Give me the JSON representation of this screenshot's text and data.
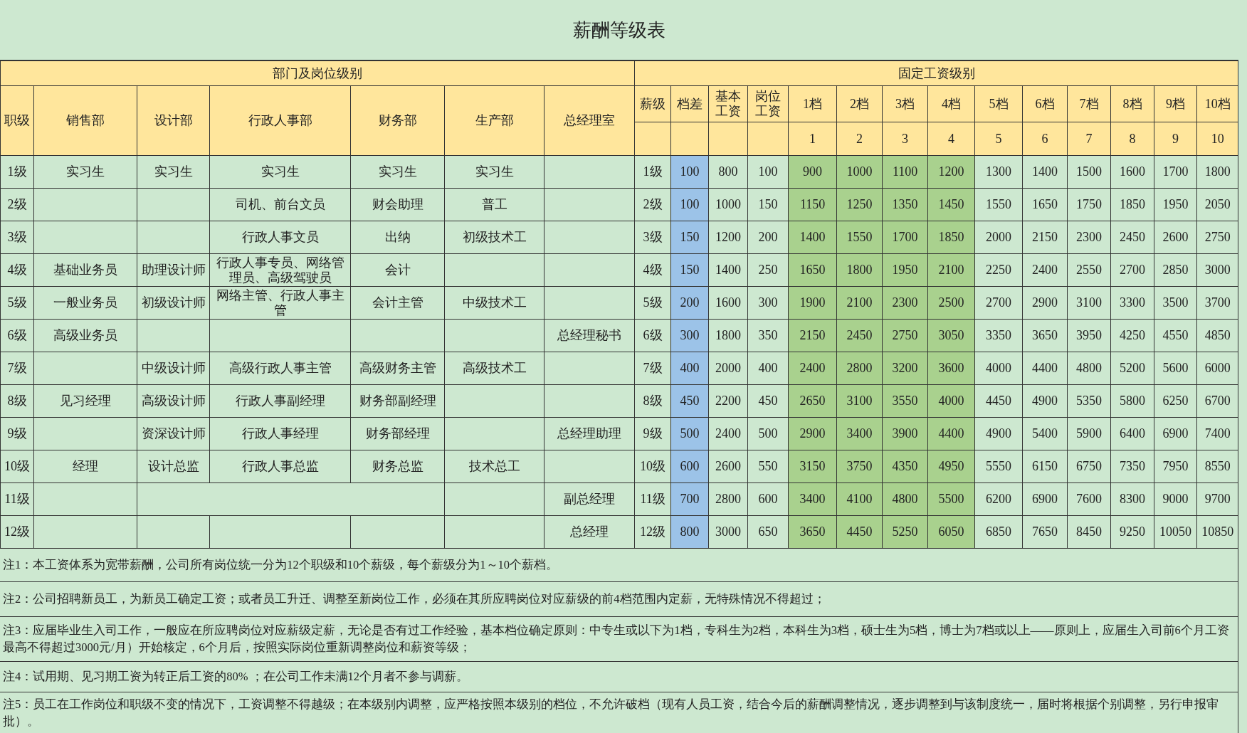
{
  "title": "薪酬等级表",
  "header": {
    "dept_group": "部门及岗位级别",
    "pay_group": "固定工资级别",
    "dept_columns": [
      "职级",
      "销售部",
      "设计部",
      "行政人事部",
      "财务部",
      "生产部",
      "总经理室"
    ],
    "pay_columns": [
      "薪级",
      "档差",
      "基本工资",
      "岗位工资"
    ],
    "step_columns": [
      {
        "label": "1档",
        "number": "1",
        "highlighted": true
      },
      {
        "label": "2档",
        "number": "2",
        "highlighted": true
      },
      {
        "label": "3档",
        "number": "3",
        "highlighted": true
      },
      {
        "label": "4档",
        "number": "4",
        "highlighted": true
      },
      {
        "label": "5档",
        "number": "5",
        "highlighted": false
      },
      {
        "label": "6档",
        "number": "6",
        "highlighted": false
      },
      {
        "label": "7档",
        "number": "7",
        "highlighted": false
      },
      {
        "label": "8档",
        "number": "8",
        "highlighted": false
      },
      {
        "label": "9档",
        "number": "9",
        "highlighted": false
      },
      {
        "label": "10档",
        "number": "10",
        "highlighted": false
      }
    ]
  },
  "rows": [
    {
      "grade": "1级",
      "positions": [
        {
          "kind": "text",
          "text": "实习生"
        },
        {
          "kind": "text",
          "text": "实习生"
        },
        {
          "kind": "text",
          "text": "实习生"
        },
        {
          "kind": "text",
          "text": "实习生"
        },
        {
          "kind": "text",
          "text": "实习生"
        },
        {
          "kind": "blank"
        }
      ],
      "pay_grade": "1级",
      "step_diff": "100",
      "base": "800",
      "post": "100",
      "steps": [
        "900",
        "1000",
        "1100",
        "1200",
        "1300",
        "1400",
        "1500",
        "1600",
        "1700",
        "1800"
      ]
    },
    {
      "grade": "2级",
      "positions": [
        {
          "kind": "blank"
        },
        {
          "kind": "blank"
        },
        {
          "kind": "text",
          "text": "司机、前台文员"
        },
        {
          "kind": "text",
          "text": "财会助理"
        },
        {
          "kind": "text",
          "text": "普工"
        },
        {
          "kind": "blank"
        }
      ],
      "pay_grade": "2级",
      "step_diff": "100",
      "base": "1000",
      "post": "150",
      "steps": [
        "1150",
        "1250",
        "1350",
        "1450",
        "1550",
        "1650",
        "1750",
        "1850",
        "1950",
        "2050"
      ]
    },
    {
      "grade": "3级",
      "positions": [
        {
          "kind": "blank"
        },
        {
          "kind": "blank"
        },
        {
          "kind": "text",
          "text": "行政人事文员"
        },
        {
          "kind": "text",
          "text": "出纳"
        },
        {
          "kind": "text",
          "text": "初级技术工"
        },
        {
          "kind": "blank"
        }
      ],
      "pay_grade": "3级",
      "step_diff": "150",
      "base": "1200",
      "post": "200",
      "steps": [
        "1400",
        "1550",
        "1700",
        "1850",
        "2000",
        "2150",
        "2300",
        "2450",
        "2600",
        "2750"
      ]
    },
    {
      "grade": "4级",
      "positions": [
        {
          "kind": "text",
          "text": "基础业务员"
        },
        {
          "kind": "text",
          "text": "助理设计师"
        },
        {
          "kind": "text",
          "text": "行政人事专员、网络管理员、高级驾驶员"
        },
        {
          "kind": "text",
          "text": "会计"
        },
        {
          "kind": "blank"
        },
        {
          "kind": "blank"
        }
      ],
      "pay_grade": "4级",
      "step_diff": "150",
      "base": "1400",
      "post": "250",
      "steps": [
        "1650",
        "1800",
        "1950",
        "2100",
        "2250",
        "2400",
        "2550",
        "2700",
        "2850",
        "3000"
      ]
    },
    {
      "grade": "5级",
      "positions": [
        {
          "kind": "text",
          "text": "一般业务员"
        },
        {
          "kind": "text",
          "text": "初级设计师"
        },
        {
          "kind": "text",
          "text": "网络主管、行政人事主管"
        },
        {
          "kind": "text",
          "text": "会计主管"
        },
        {
          "kind": "text",
          "text": "中级技术工"
        },
        {
          "kind": "blank"
        }
      ],
      "pay_grade": "5级",
      "step_diff": "200",
      "base": "1600",
      "post": "300",
      "steps": [
        "1900",
        "2100",
        "2300",
        "2500",
        "2700",
        "2900",
        "3100",
        "3300",
        "3500",
        "3700"
      ]
    },
    {
      "grade": "6级",
      "positions": [
        {
          "kind": "text",
          "text": "高级业务员"
        },
        {
          "kind": "blank"
        },
        {
          "kind": "blank"
        },
        {
          "kind": "blank"
        },
        {
          "kind": "blank"
        },
        {
          "kind": "text",
          "text": "总经理秘书"
        }
      ],
      "pay_grade": "6级",
      "step_diff": "300",
      "base": "1800",
      "post": "350",
      "steps": [
        "2150",
        "2450",
        "2750",
        "3050",
        "3350",
        "3650",
        "3950",
        "4250",
        "4550",
        "4850"
      ]
    },
    {
      "grade": "7级",
      "positions": [
        {
          "kind": "blank"
        },
        {
          "kind": "text",
          "text": "中级设计师"
        },
        {
          "kind": "text",
          "text": "高级行政人事主管"
        },
        {
          "kind": "text",
          "text": "高级财务主管"
        },
        {
          "kind": "text",
          "text": "高级技术工"
        },
        {
          "kind": "blank"
        }
      ],
      "pay_grade": "7级",
      "step_diff": "400",
      "base": "2000",
      "post": "400",
      "steps": [
        "2400",
        "2800",
        "3200",
        "3600",
        "4000",
        "4400",
        "4800",
        "5200",
        "5600",
        "6000"
      ]
    },
    {
      "grade": "8级",
      "positions": [
        {
          "kind": "text",
          "text": "见习经理"
        },
        {
          "kind": "text",
          "text": "高级设计师"
        },
        {
          "kind": "text",
          "text": "行政人事副经理"
        },
        {
          "kind": "text",
          "text": "财务部副经理"
        },
        {
          "kind": "blank"
        },
        {
          "kind": "blank"
        }
      ],
      "pay_grade": "8级",
      "step_diff": "450",
      "base": "2200",
      "post": "450",
      "steps": [
        "2650",
        "3100",
        "3550",
        "4000",
        "4450",
        "4900",
        "5350",
        "5800",
        "6250",
        "6700"
      ]
    },
    {
      "grade": "9级",
      "positions": [
        {
          "kind": "blank"
        },
        {
          "kind": "text",
          "text": "资深设计师"
        },
        {
          "kind": "text",
          "text": "行政人事经理"
        },
        {
          "kind": "text",
          "text": "财务部经理"
        },
        {
          "kind": "blank"
        },
        {
          "kind": "text",
          "text": "总经理助理"
        }
      ],
      "pay_grade": "9级",
      "step_diff": "500",
      "base": "2400",
      "post": "500",
      "steps": [
        "2900",
        "3400",
        "3900",
        "4400",
        "4900",
        "5400",
        "5900",
        "6400",
        "6900",
        "7400"
      ]
    },
    {
      "grade": "10级",
      "positions": [
        {
          "kind": "text",
          "text": "经理"
        },
        {
          "kind": "text",
          "text": "设计总监"
        },
        {
          "kind": "text",
          "text": "行政人事总监"
        },
        {
          "kind": "text",
          "text": "财务总监"
        },
        {
          "kind": "text",
          "text": "技术总工"
        },
        {
          "kind": "blank"
        }
      ],
      "pay_grade": "10级",
      "step_diff": "600",
      "base": "2600",
      "post": "550",
      "steps": [
        "3150",
        "3750",
        "4350",
        "4950",
        "5550",
        "6150",
        "6750",
        "7350",
        "7950",
        "8550"
      ]
    },
    {
      "grade": "11级",
      "positions": [
        {
          "kind": "blank"
        },
        {
          "kind": "merged_blank"
        },
        {
          "kind": "blank"
        },
        {
          "kind": "text",
          "text": "副总经理"
        }
      ],
      "pay_grade": "11级",
      "step_diff": "700",
      "base": "2800",
      "post": "600",
      "steps": [
        "3400",
        "4100",
        "4800",
        "5500",
        "6200",
        "6900",
        "7600",
        "8300",
        "9000",
        "9700"
      ]
    },
    {
      "grade": "12级",
      "positions": [
        {
          "kind": "blank"
        },
        {
          "kind": "blank"
        },
        {
          "kind": "blank"
        },
        {
          "kind": "blank"
        },
        {
          "kind": "blank"
        },
        {
          "kind": "text",
          "text": "总经理"
        }
      ],
      "pay_grade": "12级",
      "step_diff": "800",
      "base": "3000",
      "post": "650",
      "steps": [
        "3650",
        "4450",
        "5250",
        "6050",
        "6850",
        "7650",
        "8450",
        "9250",
        "10050",
        "10850"
      ]
    }
  ],
  "notes": [
    "注1：本工资体系为宽带薪酬，公司所有岗位统一分为12个职级和10个薪级，每个薪级分为1～10个薪档。",
    "注2：公司招聘新员工，为新员工确定工资；或者员工升迁、调整至新岗位工作，必须在其所应聘岗位对应薪级的前4档范围内定薪，无特殊情况不得超过；",
    "注3：应届毕业生入司工作，一般应在所应聘岗位对应薪级定薪，无论是否有过工作经验，基本档位确定原则：中专生或以下为1档，专科生为2档，本科生为3档，硕士生为5档，博士为7档或以上——原则上，应届生入司前6个月工资最高不得超过3000元/月）开始核定，6个月后，按照实际岗位重新调整岗位和薪资等级；",
    "注4：试用期、见习期工资为转正后工资的80% ；在公司工作未满12个月者不参与调薪。",
    "注5：员工在工作岗位和职级不变的情况下，工资调整不得越级；在本级别内调整，应严格按照本级别的档位，不允许破档（现有人员工资，结合今后的薪酬调整情况，逐步调整到与该制度统一，届时将根据个别调整，另行申报审批）。"
  ]
}
